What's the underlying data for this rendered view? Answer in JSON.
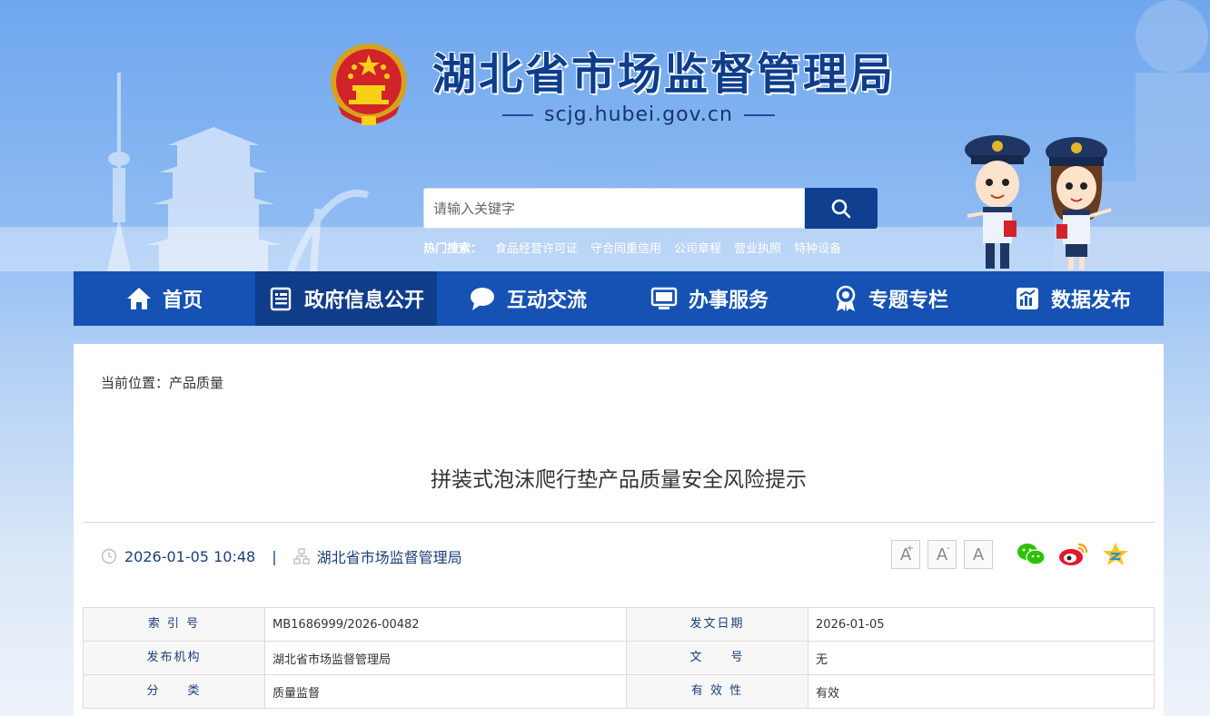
{
  "header": {
    "site_title": "湖北省市场监督管理局",
    "domain": "scjg.hubei.gov.cn",
    "search": {
      "placeholder": "请输入关键字"
    },
    "hot_label": "热门搜索：",
    "hot_links": [
      "食品经营许可证",
      "守合同重信用",
      "公司章程",
      "营业执照",
      "特种设备"
    ]
  },
  "nav": {
    "items": [
      {
        "label": "首页",
        "icon": "home-icon"
      },
      {
        "label": "政府信息公开",
        "icon": "document-icon",
        "active": true
      },
      {
        "label": "互动交流",
        "icon": "chat-icon"
      },
      {
        "label": "办事服务",
        "icon": "monitor-icon"
      },
      {
        "label": "专题专栏",
        "icon": "badge-icon"
      },
      {
        "label": "数据发布",
        "icon": "bar-chart-icon"
      }
    ]
  },
  "breadcrumb": {
    "prefix": "当前位置：",
    "current": "产品质量"
  },
  "article": {
    "title": "拼装式泡沫爬行垫产品质量安全风险提示",
    "datetime": "2026-01-05 10:48",
    "separator": "|",
    "publisher": "湖北省市场监督管理局"
  },
  "font_tools": [
    "A",
    "A",
    "A"
  ],
  "font_tool_marks": [
    "+",
    "-"
  ],
  "share": [
    "wechat-icon",
    "weibo-icon",
    "qzone-icon"
  ],
  "info_table": {
    "rows": [
      {
        "k1": "索 引 号",
        "v1": "MB1686999/2026-00482",
        "k2": "发文日期",
        "v2": "2026-01-05"
      },
      {
        "k1": "发布机构",
        "v1": "湖北省市场监督管理局",
        "k2": "文　　号",
        "v2": "无"
      },
      {
        "k1": "分　　类",
        "v1": "质量监督",
        "k2": "有 效 性",
        "v2": "有效"
      }
    ]
  },
  "colors": {
    "nav_bg": "#1552b3",
    "nav_active": "#0f3d8a",
    "title_blue": "#0d3d8c",
    "search_btn": "#0f3f8e"
  }
}
